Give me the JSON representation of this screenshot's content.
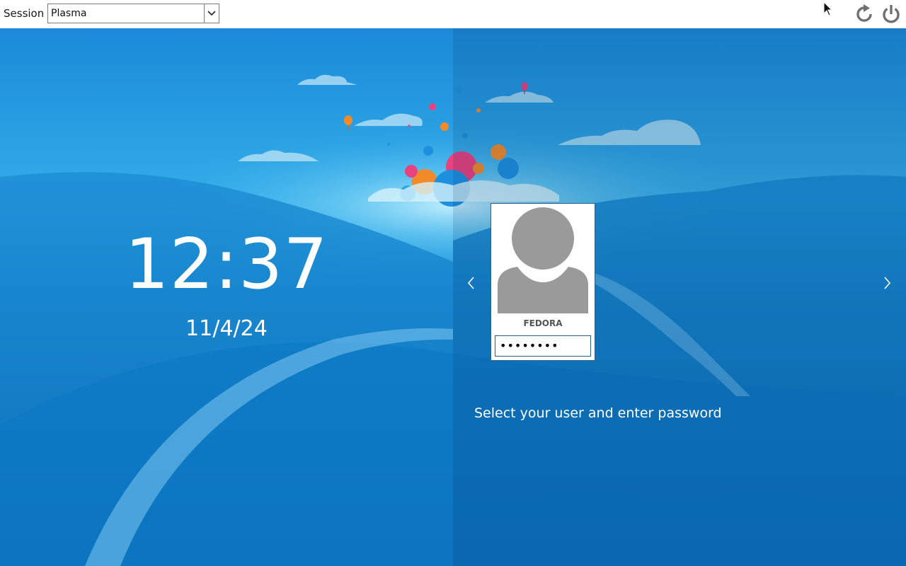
{
  "session": {
    "label": "Session",
    "selected": "Plasma"
  },
  "clock": {
    "time": "12:37",
    "date": "11/4/24"
  },
  "user": {
    "name": "FEDORA",
    "password_value": "••••••••"
  },
  "prompt": "Select your user and enter password",
  "icons": {
    "restart": "restart-icon",
    "shutdown": "power-icon",
    "prev": "chevron-left-icon",
    "next": "chevron-right-icon",
    "avatar": "user-avatar-icon",
    "cursor": "mouse-pointer-icon"
  },
  "colors": {
    "background": "#0a78c8",
    "topbar": "#ffffff",
    "avatar_gray": "#9a9a9a",
    "card_border": "#2c5e86"
  }
}
